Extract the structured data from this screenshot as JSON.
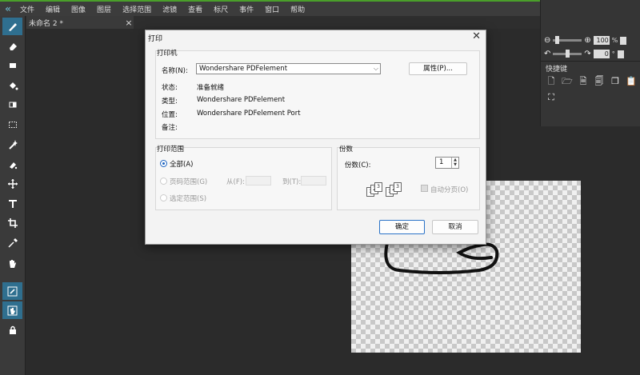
{
  "app": {
    "logo": "«",
    "menu": [
      "文件",
      "编辑",
      "图像",
      "图层",
      "选择范围",
      "滤镜",
      "查看",
      "标尺",
      "事件",
      "窗口",
      "帮助"
    ]
  },
  "tab": {
    "title": "未命名 2 *",
    "close": "×"
  },
  "right_panel": {
    "zoom_value": "100",
    "zoom_unit": "%",
    "rotate_value": "0",
    "rotate_unit": "°",
    "shortcuts_label": "快捷键"
  },
  "dialog": {
    "title": "打印",
    "close": "✕",
    "printer_group": "打印机",
    "name_label": "名称(N):",
    "printer_name": "Wondershare PDFelement",
    "properties_button": "属性(P)...",
    "status_label": "状态:",
    "status_value": "准备就绪",
    "type_label": "类型:",
    "type_value": "Wondershare PDFelement",
    "location_label": "位置:",
    "location_value": "Wondershare PDFelement Port",
    "comment_label": "备注:",
    "range_group": "打印范围",
    "all_label": "全部(A)",
    "pages_label": "页码范围(G)",
    "from_label": "从(F):",
    "to_label": "到(T):",
    "selection_label": "选定范围(S)",
    "copies_group": "份数",
    "copies_label": "份数(C):",
    "copies_value": "1",
    "collate_label": "自动分页(O)",
    "ok_button": "确定",
    "cancel_button": "取消"
  }
}
